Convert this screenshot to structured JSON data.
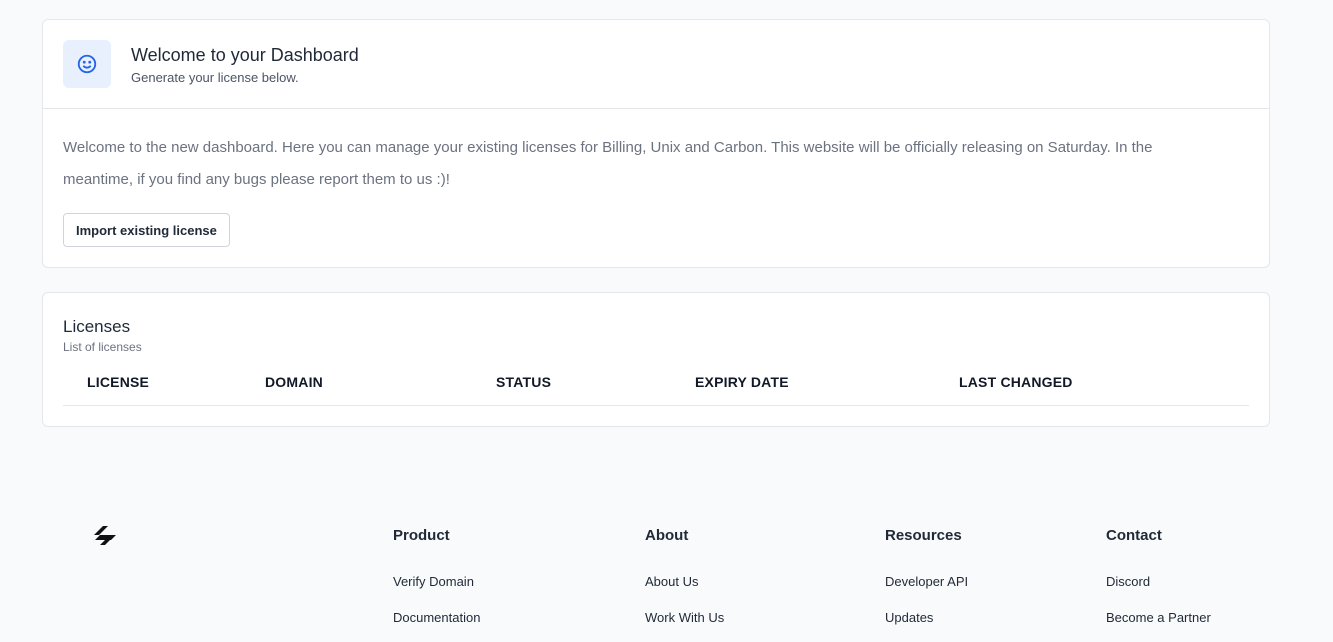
{
  "welcome": {
    "title": "Welcome to your Dashboard",
    "subtitle": "Generate your license below.",
    "body": "Welcome to the new dashboard. Here you can manage your existing licenses for Billing, Unix and Carbon. This website will be officially releasing on Saturday. In the meantime, if you find any bugs please report them to us :)!",
    "import_button": "Import existing license",
    "icon": "smiley-icon",
    "accent": "#2563eb"
  },
  "licenses": {
    "title": "Licenses",
    "subtitle": "List of licenses",
    "columns": [
      "LICENSE",
      "DOMAIN",
      "STATUS",
      "EXPIRY DATE",
      "LAST CHANGED"
    ],
    "rows": []
  },
  "footer": {
    "logo": "brand-logo-icon",
    "columns": [
      {
        "title": "Product",
        "links": [
          "Verify Domain",
          "Documentation"
        ]
      },
      {
        "title": "About",
        "links": [
          "About Us",
          "Work With Us"
        ]
      },
      {
        "title": "Resources",
        "links": [
          "Developer API",
          "Updates"
        ]
      },
      {
        "title": "Contact",
        "links": [
          "Discord",
          "Become a Partner"
        ]
      }
    ]
  }
}
